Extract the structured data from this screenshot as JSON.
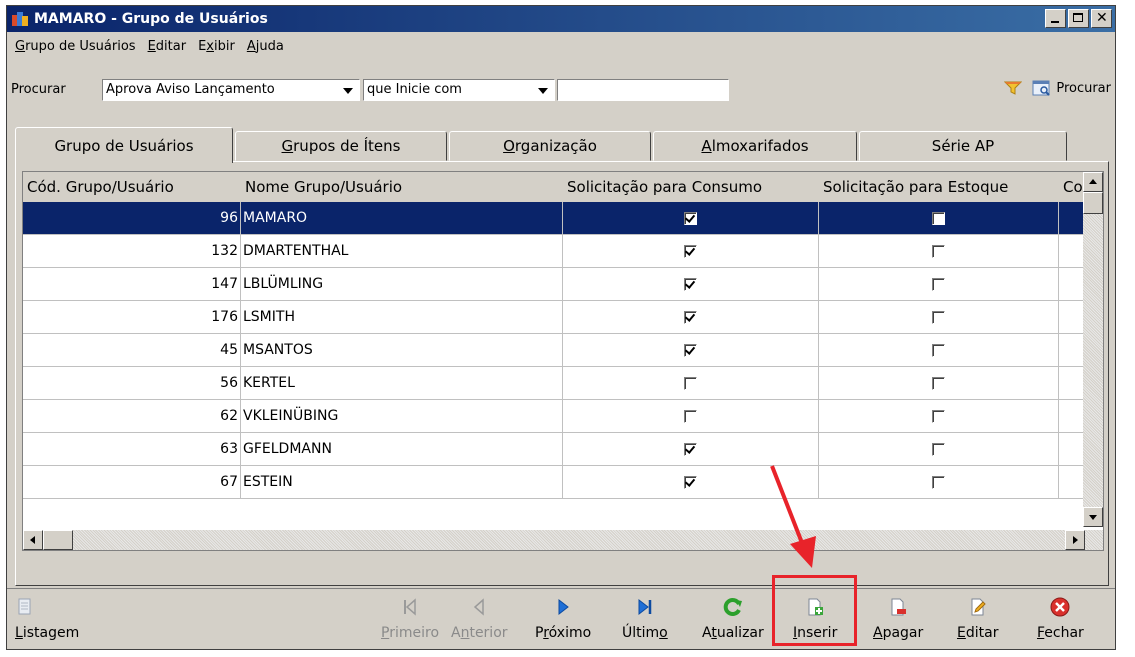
{
  "window": {
    "title": "MAMARO - Grupo de Usuários"
  },
  "menu": [
    {
      "pre": "",
      "u": "G",
      "post": "rupo de Usuários"
    },
    {
      "pre": "",
      "u": "E",
      "post": "ditar"
    },
    {
      "pre": "E",
      "u": "x",
      "post": "ibir"
    },
    {
      "pre": "",
      "u": "A",
      "post": "juda"
    }
  ],
  "search": {
    "label": "Procurar",
    "field": "Aprova Aviso Lançamento",
    "operator": "que Inicie com",
    "value": "",
    "button_label": "Procurar"
  },
  "tabs": [
    {
      "pre": "Grupo de Usuários",
      "u": "",
      "post": ""
    },
    {
      "pre": "",
      "u": "G",
      "post": "rupos de Ítens"
    },
    {
      "pre": "",
      "u": "O",
      "post": "rganização"
    },
    {
      "pre": "",
      "u": "A",
      "post": "lmoxarifados"
    },
    {
      "pre": "Série AP",
      "u": "",
      "post": ""
    }
  ],
  "grid": {
    "columns": [
      "Cód. Grupo/Usuário",
      "Nome Grupo/Usuário",
      "Solicitação para Consumo",
      "Solicitação para Estoque",
      "Co"
    ],
    "rows": [
      {
        "code": "96",
        "name": "MAMARO",
        "consumo": true,
        "estoque": false,
        "selected": true
      },
      {
        "code": "132",
        "name": "DMARTENTHAL",
        "consumo": true,
        "estoque": false
      },
      {
        "code": "147",
        "name": "LBLÜMLING",
        "consumo": true,
        "estoque": false
      },
      {
        "code": "176",
        "name": "LSMITH",
        "consumo": true,
        "estoque": false
      },
      {
        "code": "45",
        "name": "MSANTOS",
        "consumo": true,
        "estoque": false
      },
      {
        "code": "56",
        "name": "KERTEL",
        "consumo": false,
        "estoque": false
      },
      {
        "code": "62",
        "name": "VKLEINÜBING",
        "consumo": false,
        "estoque": false
      },
      {
        "code": "63",
        "name": "GFELDMANN",
        "consumo": true,
        "estoque": false
      },
      {
        "code": "67",
        "name": "ESTEIN",
        "consumo": true,
        "estoque": false
      }
    ]
  },
  "toolbar": {
    "listagem": {
      "pre": "",
      "u": "L",
      "post": "istagem"
    },
    "primeiro": {
      "pre": "",
      "u": "P",
      "post": "rimeiro"
    },
    "anterior": {
      "pre": "A",
      "u": "n",
      "post": "terior"
    },
    "proximo": {
      "pre": "P",
      "u": "r",
      "post": "óximo"
    },
    "ultimo": {
      "pre": "Últim",
      "u": "o",
      "post": ""
    },
    "atualizar": {
      "pre": "A",
      "u": "t",
      "post": "ualizar"
    },
    "inserir": {
      "pre": "",
      "u": "I",
      "post": "nserir"
    },
    "apagar": {
      "pre": "",
      "u": "A",
      "post": "pagar"
    },
    "editar": {
      "pre": "",
      "u": "E",
      "post": "ditar"
    },
    "fechar": {
      "pre": "",
      "u": "F",
      "post": "echar"
    }
  },
  "colors": {
    "title_bg": "#0a246a",
    "selection": "#0a246a",
    "highlight": "#e8232a",
    "play": "#1f6fd6",
    "refresh": "#2ca02c",
    "close": "#d9302c"
  }
}
